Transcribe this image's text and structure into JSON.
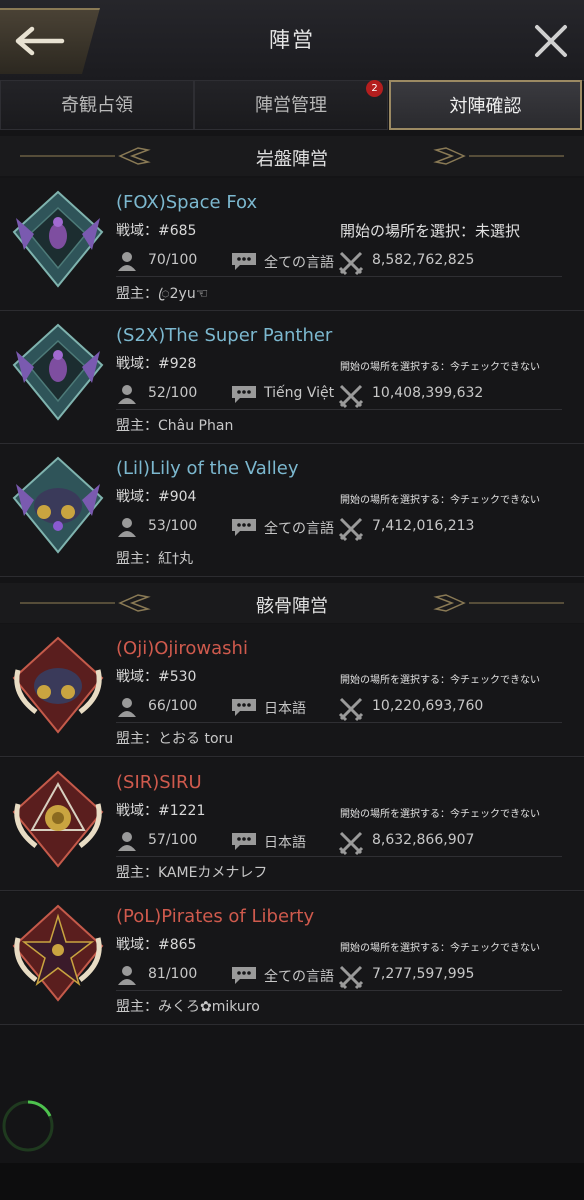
{
  "header": {
    "title": "陣営",
    "back_icon": "back-arrow-icon",
    "close_icon": "close-icon"
  },
  "tabs": [
    {
      "label": "奇観占領",
      "active": false
    },
    {
      "label": "陣営管理",
      "active": false,
      "badge": "2"
    },
    {
      "label": "対陣確認",
      "active": true
    }
  ],
  "sections": [
    {
      "title": "岩盤陣営",
      "alliances": [
        {
          "name": "(FOX)Space Fox",
          "server": "戦域：#685",
          "start": "開始の場所を選択：未選択",
          "members": "70/100",
          "language": "全ての言語",
          "power": "8,582,762,825",
          "leader": "盟主：ꦿ2yu☜"
        },
        {
          "name": "(S2X)The Super Panther",
          "server": "戦域：#928",
          "start": "開始の場所を選択する：今チェックできない",
          "members": "52/100",
          "language": "Tiếng Việt",
          "power": "10,408,399,632",
          "leader": "盟主：Châu Phan"
        },
        {
          "name": "(Lil)Lily of the Valley",
          "server": "戦域：#904",
          "start": "開始の場所を選択する：今チェックできない",
          "members": "53/100",
          "language": "全ての言語",
          "power": "7,412,016,213",
          "leader": "盟主：紅†丸"
        }
      ]
    },
    {
      "title": "骸骨陣営",
      "alliances": [
        {
          "name": "(Oji)Ojirowashi",
          "server": "戦域：#530",
          "start": "開始の場所を選択する：今チェックできない",
          "members": "66/100",
          "language": "日本語",
          "power": "10,220,693,760",
          "leader": "盟主：とおる toru"
        },
        {
          "name": "(SIR)SIRU",
          "server": "戦域：#1221",
          "start": "開始の場所を選択する：今チェックできない",
          "members": "57/100",
          "language": "日本語",
          "power": "8,632,866,907",
          "leader": "盟主：KAMEカメナレフ"
        },
        {
          "name": "(PoL)Pirates of Liberty",
          "server": "戦域：#865",
          "start": "開始の場所を選択する：今チェックできない",
          "members": "81/100",
          "language": "全ての言語",
          "power": "7,277,597,995",
          "leader": "盟主：みくろ✿mikuro"
        }
      ]
    }
  ],
  "colors": {
    "bedrock": "#7cb8cf",
    "skeleton": "#cf5a4d",
    "accent": "#9c8a63"
  }
}
